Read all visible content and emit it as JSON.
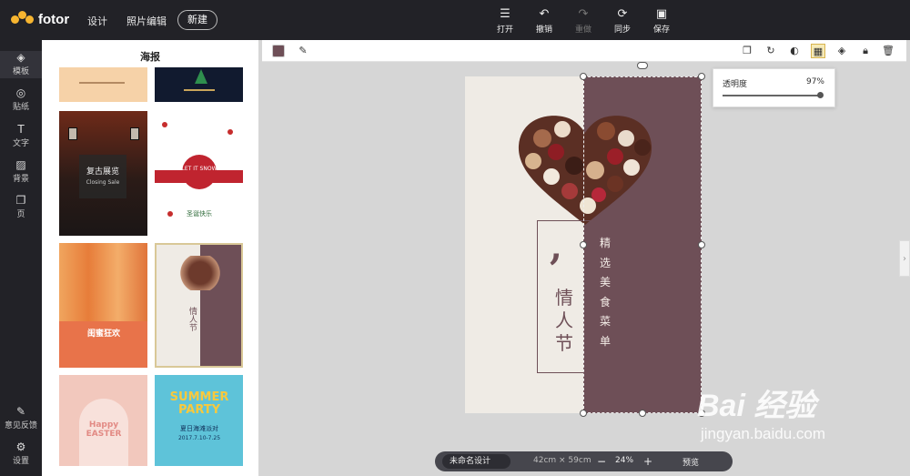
{
  "app": {
    "logo_text": "fotor",
    "brand_color": "#f7b530"
  },
  "topnav": {
    "design": "设计",
    "photo_edit": "照片编辑",
    "new_button": "新建"
  },
  "toolbar": {
    "open": "打开",
    "undo": "撤销",
    "redo": "重做",
    "sync": "同步",
    "save": "保存"
  },
  "leftnav": {
    "templates": "模板",
    "stickers": "贴纸",
    "text": "文字",
    "background": "背景",
    "page": "页",
    "feedback": "意见反馈",
    "settings": "设置"
  },
  "panel": {
    "title": "海报",
    "templates": [
      {
        "name": "beige-template",
        "caption": ""
      },
      {
        "name": "christmas-dark-template",
        "caption": ""
      },
      {
        "name": "exhibition-template",
        "title": "复古展览",
        "subtitle": "Closing Sale"
      },
      {
        "name": "snow-template",
        "title": "LET IT SNOW",
        "subtitle": "圣诞快乐"
      },
      {
        "name": "clothing-template",
        "title": "闺蜜狂欢"
      },
      {
        "name": "valentine-template",
        "title": "情人节"
      },
      {
        "name": "easter-template",
        "title": "Happy EASTER"
      },
      {
        "name": "summer-party-template",
        "title": "SUMMER PARTY",
        "subtitle": "夏日海滩派对",
        "date": "2017.7.10-7.25"
      }
    ]
  },
  "canvas_toolbar": {
    "fill_color": "#6e4f57"
  },
  "poster": {
    "left_bg": "#efebe5",
    "right_bg": "#6e4f57",
    "quote_mark": ",",
    "title_chars": [
      "情",
      "人",
      "节"
    ],
    "menu_chars": [
      "精",
      "选",
      "美",
      "食",
      "菜",
      "单"
    ]
  },
  "opacity_popup": {
    "label": "透明度",
    "value_text": "97%",
    "value": 0.97
  },
  "bottombar": {
    "design_name": "未命名设计",
    "size": "42cm × 59cm",
    "zoom_out": "−",
    "zoom": "24%",
    "zoom_in": "+",
    "preview": "预览"
  },
  "watermark": {
    "main": "Bai 经验",
    "sub": "jingyan.baidu.com"
  }
}
